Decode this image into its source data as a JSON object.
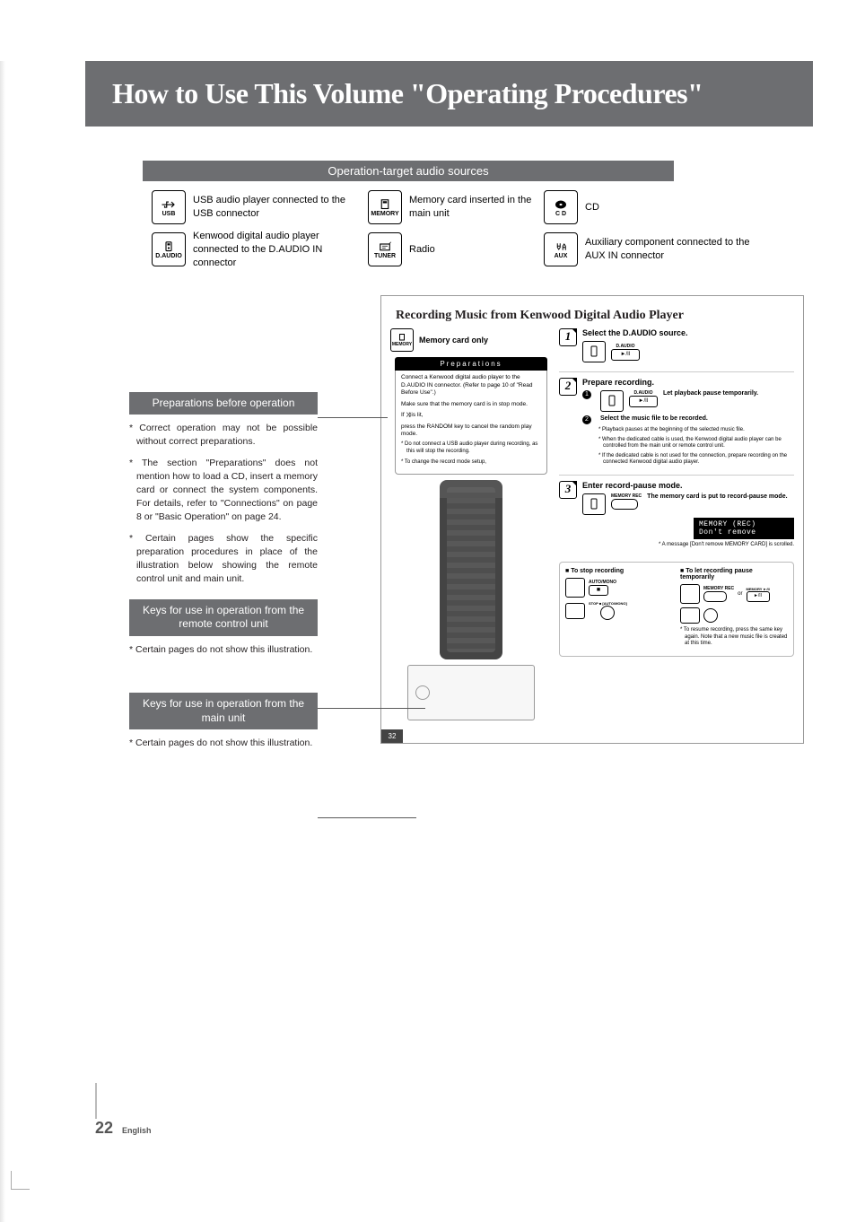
{
  "title": "How to Use This Volume \"Operating Procedures\"",
  "sources_header": "Operation-target audio sources",
  "sources": {
    "usb": "USB audio player connected to the USB connector",
    "memory": "Memory card inserted in the main unit",
    "cd": "CD",
    "daudio": "Kenwood digital audio player connected to the D.AUDIO IN connector",
    "tuner": "Radio",
    "aux": "Auxiliary component connected to the AUX IN connector"
  },
  "callouts": {
    "prep_title": "Preparations before operation",
    "prep_p1": "* Correct operation may not be possible without correct preparations.",
    "prep_p2": "* The section \"Preparations\" does not mention how to load a CD, insert a memory card or connect the system components. For details, refer to \"Connections\" on page 8 or \"Basic Operation\" on page 24.",
    "prep_p3": "* Certain pages show the specific preparation procedures in place of the illustration below showing the remote control unit and main unit.",
    "remote_title": "Keys for use in operation from the remote control unit",
    "remote_p1": "* Certain pages do not show this illustration.",
    "main_title": "Keys for use in operation from the main unit",
    "main_p1": "* Certain pages do not show this illustration."
  },
  "sample": {
    "title": "Recording Music from Kenwood Digital Audio Player",
    "memory_only": "Memory card only",
    "prep_header": "Preparations",
    "prep1": "Connect a Kenwood digital audio player to the D.AUDIO IN connector. (Refer to page 10 of \"Read Before Use\".)",
    "prep2": "Make sure that the memory card is in stop mode.",
    "prep3a": "If ",
    "prep3b": " is lit,",
    "prep4": "press the RANDOM key to cancel the random play mode.",
    "prep_note1": "* Do not connect a USB audio player during recording, as this will stop the recording.",
    "prep_note2": "* To change the record mode setup,",
    "step1": {
      "title": "Select the D.AUDIO source.",
      "btn": "D.AUDIO"
    },
    "step2": {
      "title": "Prepare recording.",
      "sub1": "Let playback pause temporarily.",
      "sub2": "Select the music file to be recorded.",
      "note1": "* Playback pauses at the beginning of the selected music file.",
      "note2": "* When the dedicated cable is used, the Kenwood digital audio player can be controlled from the main unit or remote control unit.",
      "note3": "* If the dedicated cable is not used for the connection, prepare recording on the connected Kenwood digital audio player."
    },
    "step3": {
      "title": "Enter record-pause mode.",
      "sub1": "The memory card is put to record-pause mode.",
      "btn": "MEMORY REC",
      "display1": "MEMORY (REC)",
      "display2": "Don't remove",
      "note1": "* A message [Don't remove MEMORY CARD] is scrolled."
    },
    "stop": {
      "col1_title": "To stop recording",
      "col1_btn1": "AUTO/MONO",
      "col1_btn2": "STOP ■ [AUTO/MONO]",
      "col2_title": "To let recording pause temporarily",
      "col2_btn1": "MEMORY REC",
      "col2_btn2": "MEMORY ►/II",
      "col2_or": "or",
      "note1": "* To resume recording, press the same key again. Note that a new music file is created at this time."
    },
    "pagenum": "32"
  },
  "footer": {
    "page": "22",
    "lang": "English"
  },
  "icon_labels": {
    "usb": "USB",
    "memory": "MEMORY",
    "cd": "C D",
    "daudio": "D.AUDIO",
    "tuner": "TUNER",
    "aux": "AUX"
  }
}
